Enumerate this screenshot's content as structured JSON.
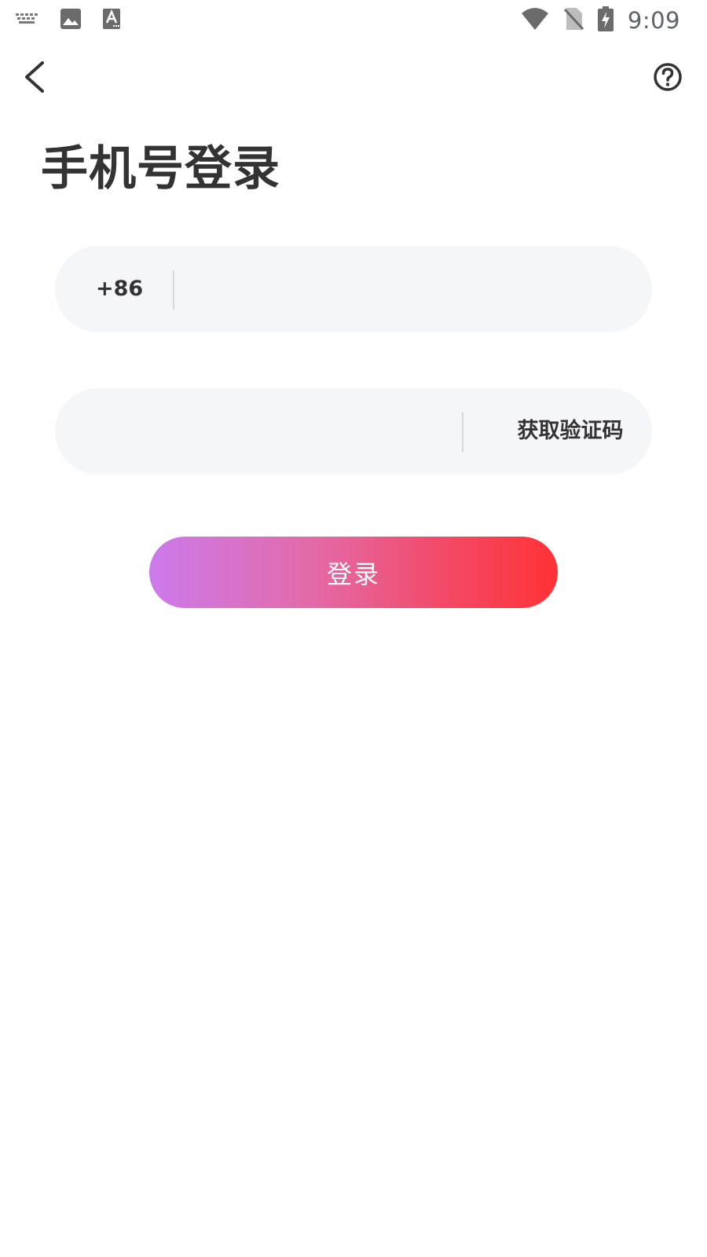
{
  "status_bar": {
    "time": "9:09",
    "icons": [
      "keyboard-icon",
      "image-icon",
      "font-icon",
      "wifi-icon",
      "no-sim-icon",
      "battery-charging-icon"
    ]
  },
  "nav": {
    "back_icon": "chevron-left-icon",
    "help_icon": "help-circle-icon"
  },
  "title": "手机号登录",
  "phone_field": {
    "country_code": "+86",
    "value": "",
    "placeholder": ""
  },
  "code_field": {
    "value": "",
    "placeholder": "",
    "get_code_label": "获取验证码"
  },
  "login_button": {
    "label": "登录"
  },
  "colors": {
    "field_bg": "#f5f6f8",
    "text": "#333333",
    "gradient_start": "#cc7aec",
    "gradient_end": "#ff3235"
  }
}
